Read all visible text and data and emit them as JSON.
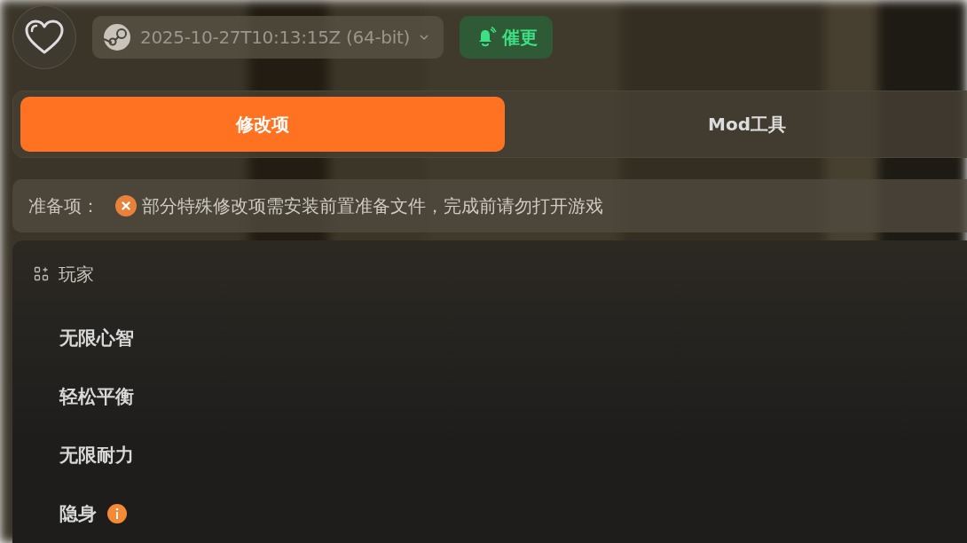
{
  "header": {
    "version": "2025-10-27T10:13:15Z (64-bit)",
    "urge_button": "催更"
  },
  "tabs": [
    {
      "label": "修改项",
      "selected": true
    },
    {
      "label": "Mod工具",
      "selected": false
    }
  ],
  "prerequisites": {
    "label": "准备项：",
    "kind": "error",
    "message": "部分特殊修改项需安装前置准备文件，完成前请勿打开游戏"
  },
  "section": {
    "title": "玩家",
    "items": [
      {
        "label": "无限心智",
        "info": false
      },
      {
        "label": "轻松平衡",
        "info": false
      },
      {
        "label": "无限耐力",
        "info": false
      },
      {
        "label": "隐身",
        "info": true
      }
    ]
  }
}
